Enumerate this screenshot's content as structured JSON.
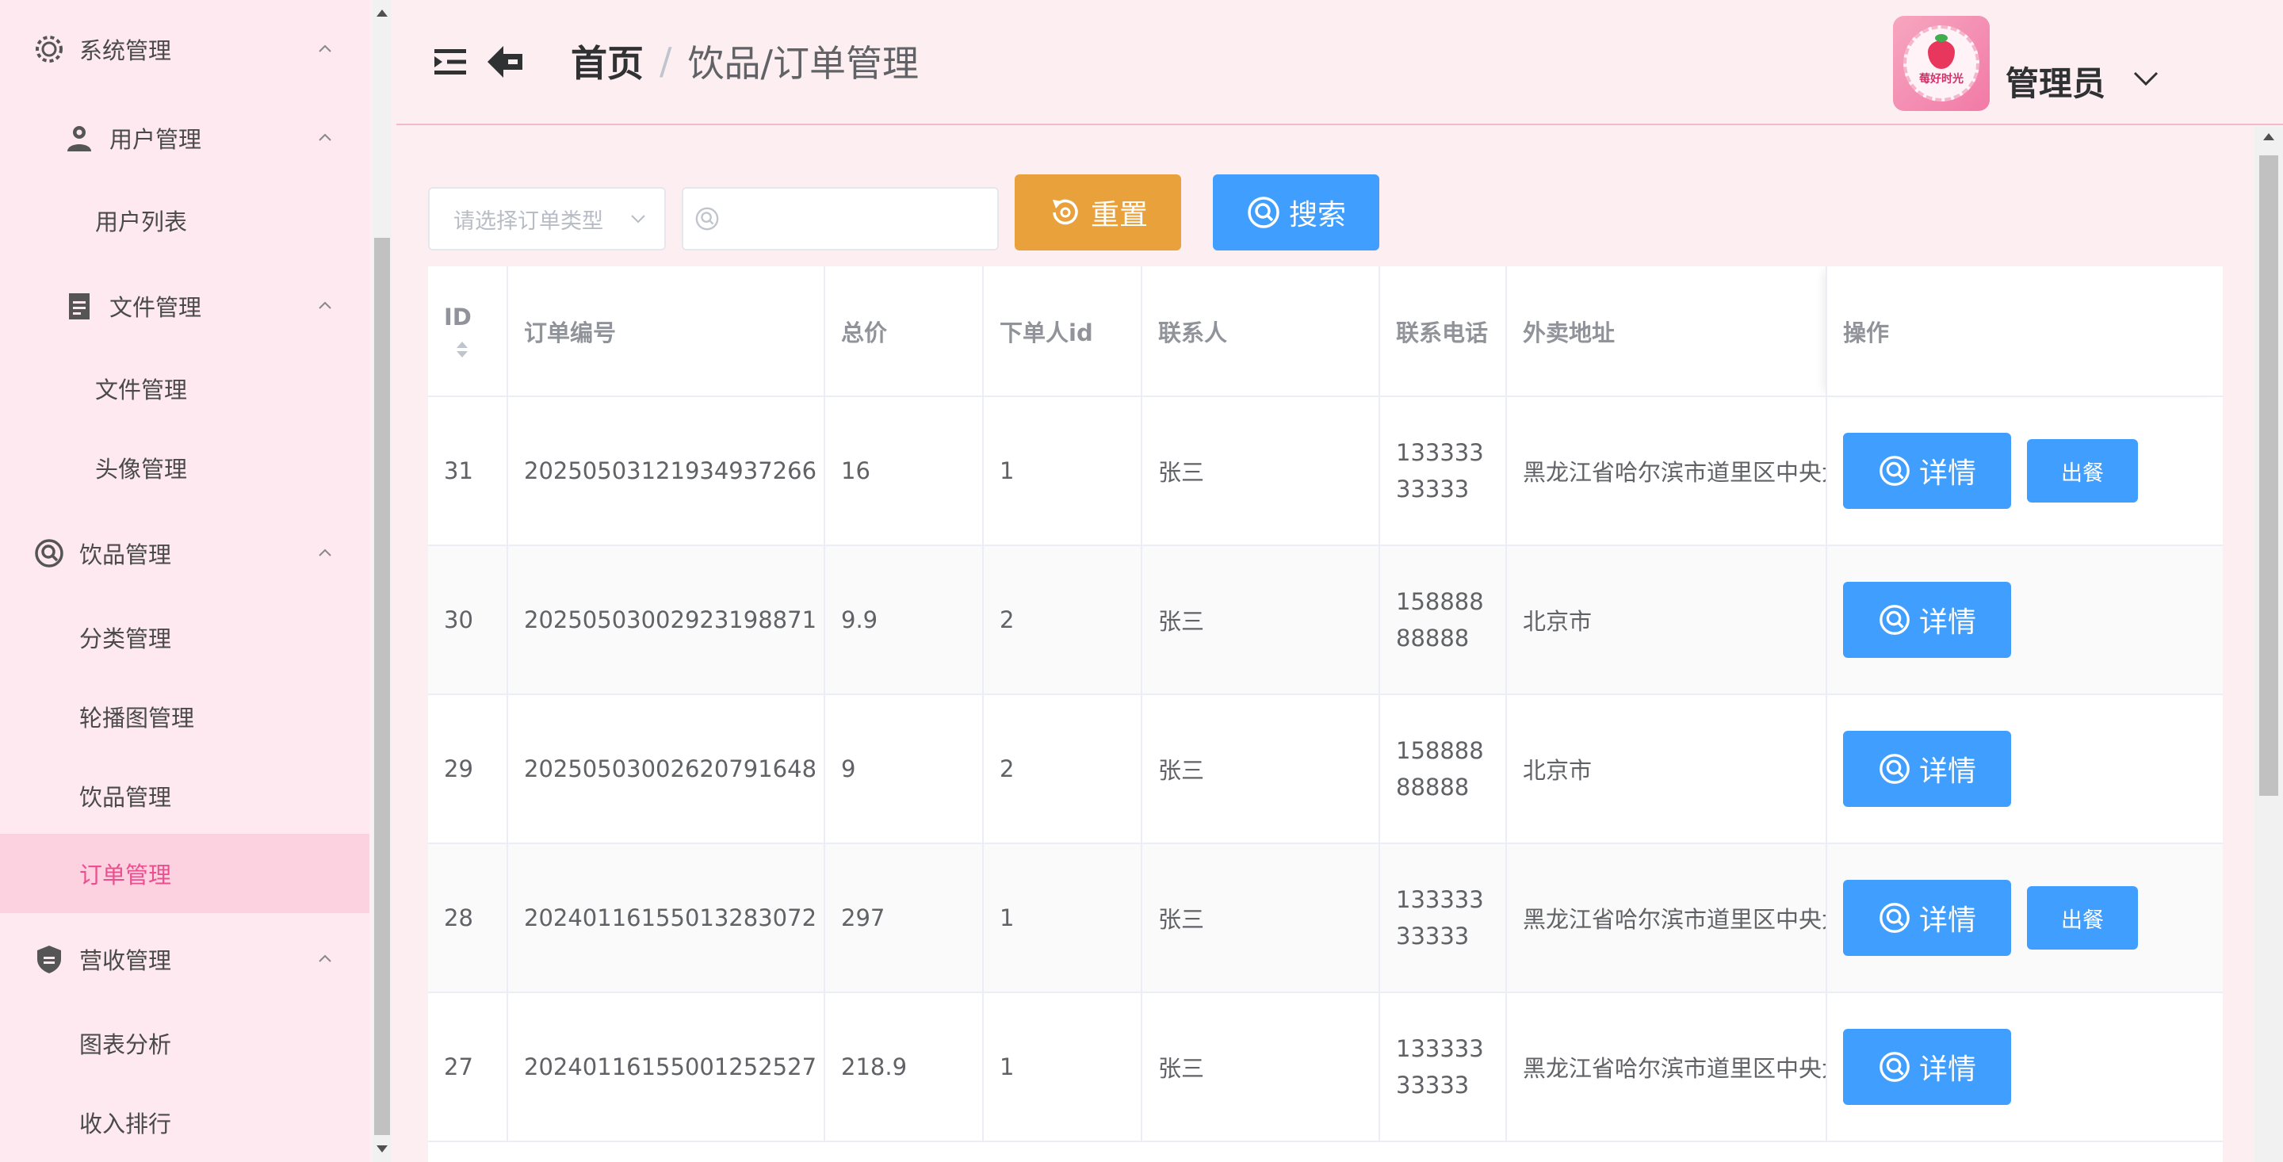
{
  "sidebar": {
    "menus": [
      {
        "label": "系统管理",
        "icon": "gear-icon"
      },
      {
        "label": "用户管理",
        "icon": "user-icon"
      },
      {
        "label": "用户列表"
      },
      {
        "label": "文件管理",
        "icon": "document-icon"
      },
      {
        "label": "文件管理"
      },
      {
        "label": "头像管理"
      },
      {
        "label": "饮品管理",
        "icon": "search-circle-icon"
      },
      {
        "label": "分类管理"
      },
      {
        "label": "轮播图管理"
      },
      {
        "label": "饮品管理"
      },
      {
        "label": "订单管理",
        "active": true
      },
      {
        "label": "营收管理",
        "icon": "shield-icon"
      },
      {
        "label": "图表分析"
      },
      {
        "label": "收入排行"
      }
    ]
  },
  "header": {
    "breadcrumb_home": "首页",
    "breadcrumb_sep": "/",
    "breadcrumb_current": "饮品/订单管理",
    "user_name": "管理员",
    "avatar_text": "莓好时光"
  },
  "toolbar": {
    "select_placeholder": "请选择订单类型",
    "search_placeholder": "",
    "reset_label": "重置",
    "search_label": "搜索"
  },
  "table": {
    "columns": [
      "ID",
      "订单编号",
      "总价",
      "下单人id",
      "联系人",
      "联系电话",
      "外卖地址",
      "操作"
    ],
    "rows": [
      {
        "id": "31",
        "order_no": "20250503121934937266",
        "total": "16",
        "user_id": "1",
        "contact": "张三",
        "phone": "13333333333",
        "address": "黑龙江省哈尔滨市道里区中央大街",
        "detail": "详情",
        "serve": "出餐"
      },
      {
        "id": "30",
        "order_no": "20250503002923198871",
        "total": "9.9",
        "user_id": "2",
        "contact": "张三",
        "phone": "15888888888",
        "address": "北京市",
        "detail": "详情",
        "serve": ""
      },
      {
        "id": "29",
        "order_no": "20250503002620791648",
        "total": "9",
        "user_id": "2",
        "contact": "张三",
        "phone": "15888888888",
        "address": "北京市",
        "detail": "详情",
        "serve": ""
      },
      {
        "id": "28",
        "order_no": "20240116155013283072",
        "total": "297",
        "user_id": "1",
        "contact": "张三",
        "phone": "13333333333",
        "address": "黑龙江省哈尔滨市道里区中央大街",
        "detail": "详情",
        "serve": "出餐"
      },
      {
        "id": "27",
        "order_no": "20240116155001252527",
        "total": "218.9",
        "user_id": "1",
        "contact": "张三",
        "phone": "13333333333",
        "address": "黑龙江省哈尔滨市道里区中央大街",
        "detail": "详情",
        "serve": ""
      }
    ]
  },
  "colors": {
    "primary": "#409eff",
    "warning": "#e9a23b",
    "active_menu": "#ec4f8f",
    "active_bg": "#fdd2e0",
    "page_bg": "#fdeef2"
  }
}
